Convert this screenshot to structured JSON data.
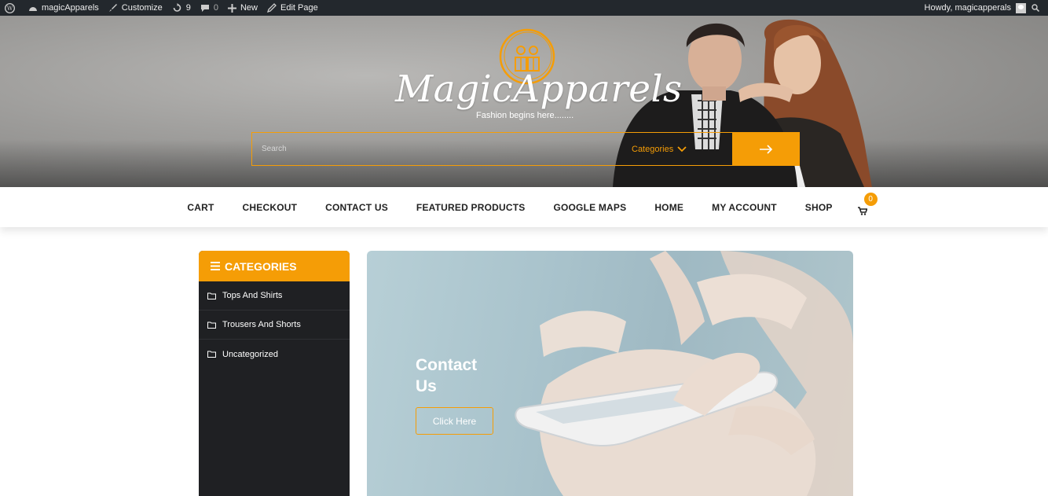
{
  "admin_bar": {
    "site_name": "magicApparels",
    "customize": "Customize",
    "updates_count": "9",
    "comments_count": "0",
    "new_label": "New",
    "edit_page": "Edit Page",
    "howdy": "Howdy, magicapperals"
  },
  "header": {
    "brand": "MagicApparels",
    "tagline": "Fashion begins here........",
    "search": {
      "placeholder": "Search",
      "category_label": "Categories"
    }
  },
  "nav": {
    "items": [
      "CART",
      "CHECKOUT",
      "CONTACT US",
      "FEATURED PRODUCTS",
      "GOOGLE MAPS",
      "HOME",
      "MY ACCOUNT",
      "SHOP"
    ],
    "cart_count": "0"
  },
  "sidebar": {
    "title": "CATEGORIES",
    "items": [
      "Tops And Shirts",
      "Trousers And Shorts",
      "Uncategorized"
    ]
  },
  "hero": {
    "title": "Contact Us",
    "button": "Click Here"
  },
  "colors": {
    "accent": "#f59d06",
    "adminbar": "#23282d",
    "sidebar": "#1f2023"
  }
}
